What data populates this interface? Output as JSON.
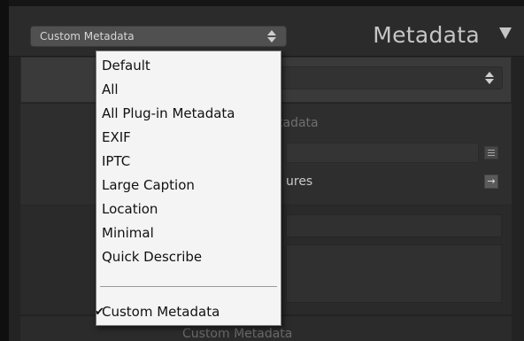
{
  "header": {
    "preset_label": "Custom Metadata",
    "title": "Metadata",
    "collapse_icon": "triangle-down-icon"
  },
  "panel": {
    "section_title": "tadata",
    "features_text": "ures",
    "footer_label": "Custom Metadata"
  },
  "menu": {
    "items": [
      "Default",
      "All",
      "All Plug-in Metadata",
      "EXIF",
      "IPTC",
      "Large Caption",
      "Location",
      "Minimal",
      "Quick Describe"
    ],
    "selected_label": "Custom Metadata",
    "check_glyph": "✔"
  }
}
